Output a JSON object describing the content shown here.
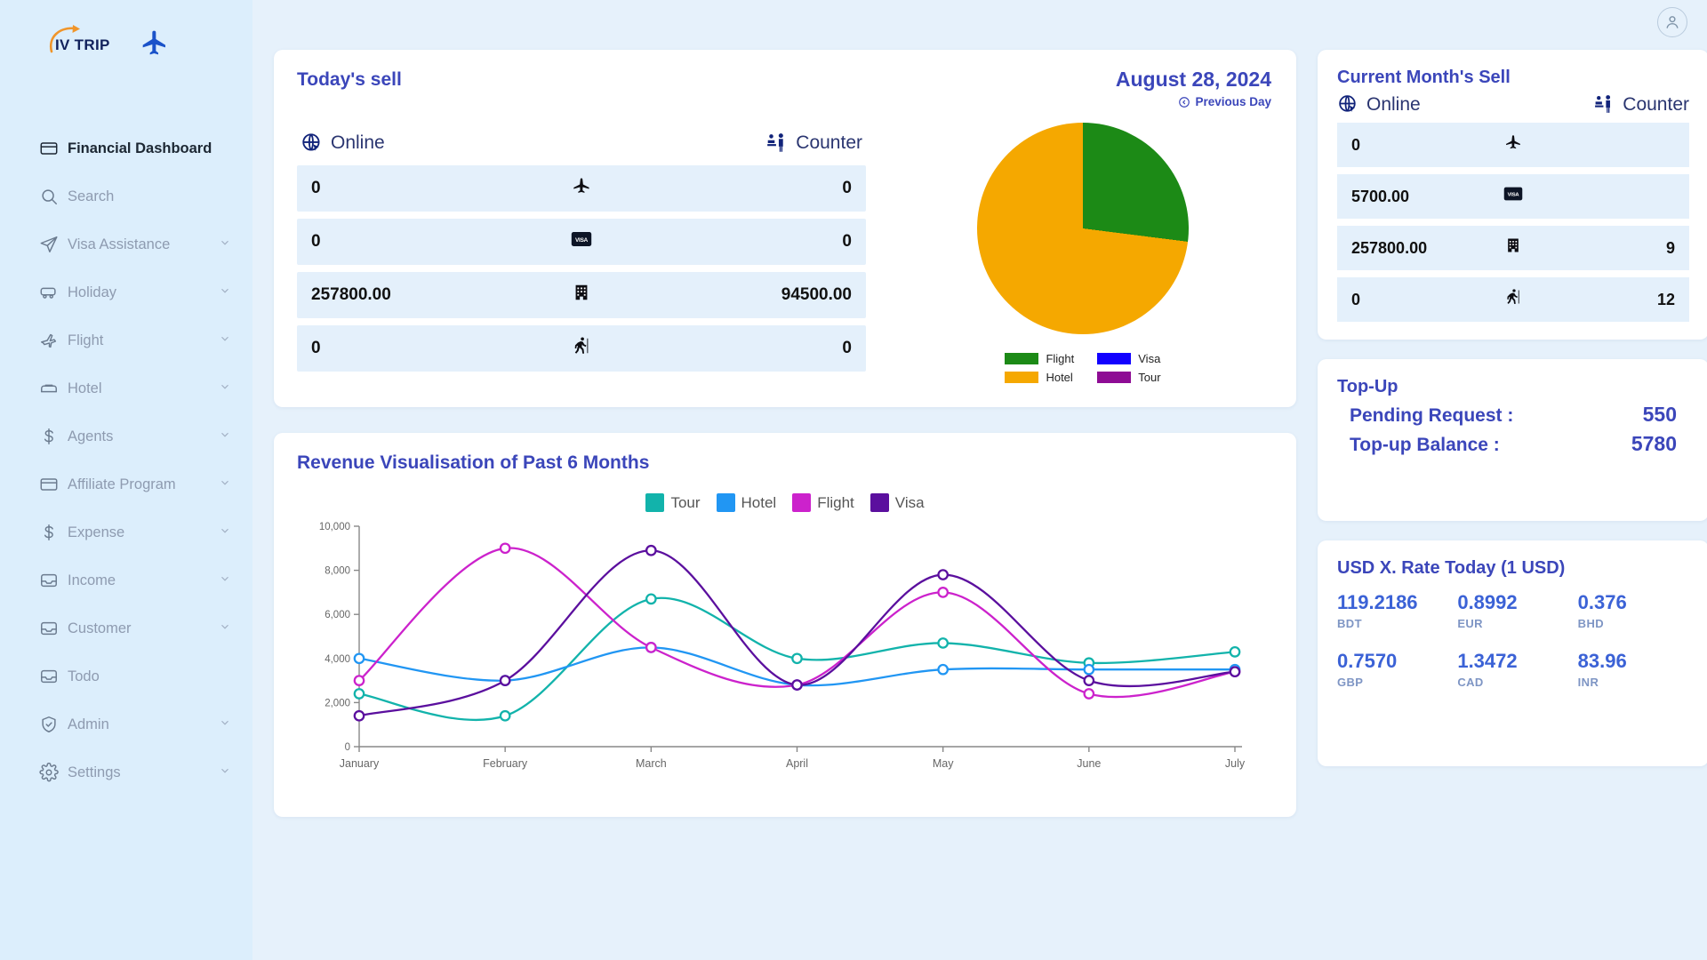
{
  "brand": {
    "name": "IV TRIP",
    "plane_icon": "airplane-icon"
  },
  "topbar": {
    "avatar_icon": "user-avatar-icon"
  },
  "sidebar": {
    "items": [
      {
        "label": "Financial Dashboard",
        "icon": "credit-card-icon",
        "active": true,
        "chevron": false
      },
      {
        "label": "Search",
        "icon": "search-icon",
        "active": false,
        "chevron": false
      },
      {
        "label": "Visa Assistance",
        "icon": "send-icon",
        "active": false,
        "chevron": true
      },
      {
        "label": "Holiday",
        "icon": "bus-icon",
        "active": false,
        "chevron": true
      },
      {
        "label": "Flight",
        "icon": "flight-icon",
        "active": false,
        "chevron": true
      },
      {
        "label": "Hotel",
        "icon": "bed-icon",
        "active": false,
        "chevron": true
      },
      {
        "label": "Agents",
        "icon": "dollar-icon",
        "active": false,
        "chevron": true
      },
      {
        "label": "Affiliate Program",
        "icon": "credit-card-icon",
        "active": false,
        "chevron": true
      },
      {
        "label": "Expense",
        "icon": "dollar-icon",
        "active": false,
        "chevron": true
      },
      {
        "label": "Income",
        "icon": "inbox-icon",
        "active": false,
        "chevron": true
      },
      {
        "label": "Customer",
        "icon": "inbox-icon",
        "active": false,
        "chevron": true
      },
      {
        "label": "Todo",
        "icon": "inbox-icon",
        "active": false,
        "chevron": false
      },
      {
        "label": "Admin",
        "icon": "shield-check-icon",
        "active": false,
        "chevron": true
      },
      {
        "label": "Settings",
        "icon": "gear-icon",
        "active": false,
        "chevron": true
      }
    ]
  },
  "todays_sell": {
    "title": "Today's sell",
    "date": "August 28, 2024",
    "previous_day_label": "Previous Day",
    "col_online": "Online",
    "col_counter": "Counter",
    "rows": [
      {
        "icon": "airplane-icon",
        "online": "0",
        "counter": "0"
      },
      {
        "icon": "visa-card-icon",
        "online": "0",
        "counter": "0"
      },
      {
        "icon": "hotel-icon",
        "online": "257800.00",
        "counter": "94500.00"
      },
      {
        "icon": "hiking-icon",
        "online": "0",
        "counter": "0"
      }
    ]
  },
  "current_month_sell": {
    "title": "Current Month's Sell",
    "col_online": "Online",
    "col_counter": "Counter",
    "rows": [
      {
        "icon": "airplane-icon",
        "online": "0",
        "counter": ""
      },
      {
        "icon": "visa-card-icon",
        "online": "5700.00",
        "counter": ""
      },
      {
        "icon": "hotel-icon",
        "online": "257800.00",
        "counter": "9"
      },
      {
        "icon": "hiking-icon",
        "online": "0",
        "counter": "12"
      }
    ]
  },
  "topup": {
    "title": "Top-Up",
    "pending_label": "Pending Request :",
    "pending_value": "550",
    "balance_label": "Top-up Balance :",
    "balance_value": "5780"
  },
  "fx": {
    "title": "USD X. Rate Today (1 USD)",
    "rates": [
      {
        "value": "119.2186",
        "code": "BDT"
      },
      {
        "value": "0.8992",
        "code": "EUR"
      },
      {
        "value": "0.376",
        "code": "BHD"
      },
      {
        "value": "0.7570",
        "code": "GBP"
      },
      {
        "value": "1.3472",
        "code": "CAD"
      },
      {
        "value": "83.96",
        "code": "INR"
      }
    ]
  },
  "colors": {
    "accent": "#3b46ba",
    "flight_green": "#1c8a16",
    "hotel_orange": "#f5a800",
    "visa_blue": "#1200ff",
    "tour_purple": "#8e0c94",
    "line_tour": "#12b3ab",
    "line_hotel": "#2196f3",
    "line_flight": "#cc22cc",
    "line_visa": "#5b0f9e",
    "row_bg": "#e4f0fb",
    "sidebar_bg": "#dceefc"
  },
  "chart_data": [
    {
      "type": "pie",
      "title": "",
      "labels": [
        "Flight",
        "Hotel",
        "Visa",
        "Tour"
      ],
      "values": [
        27,
        73,
        0,
        0
      ],
      "colors": [
        "#1c8a16",
        "#f5a800",
        "#1200ff",
        "#8e0c94"
      ],
      "legend": "bottom-center"
    },
    {
      "type": "line",
      "title": "Revenue Visualisation of Past 6 Months",
      "categories": [
        "January",
        "February",
        "March",
        "April",
        "May",
        "June",
        "July"
      ],
      "xlabel": "",
      "ylabel": "",
      "ylim": [
        0,
        10000
      ],
      "yticks": [
        0,
        2000,
        4000,
        6000,
        8000,
        10000
      ],
      "ytick_labels": [
        "0",
        "2,000",
        "4,000",
        "6,000",
        "8,000",
        "10,000"
      ],
      "grid": false,
      "legend": "top-center",
      "series": [
        {
          "name": "Tour",
          "color": "#12b3ab",
          "values": [
            2400,
            1400,
            6700,
            4000,
            4700,
            3800,
            4300
          ]
        },
        {
          "name": "Hotel",
          "color": "#2196f3",
          "values": [
            4000,
            3000,
            4500,
            2800,
            3500,
            3500,
            3500
          ]
        },
        {
          "name": "Flight",
          "color": "#cc22cc",
          "values": [
            3000,
            9000,
            4500,
            2800,
            7000,
            2400,
            3400
          ]
        },
        {
          "name": "Visa",
          "color": "#5b0f9e",
          "values": [
            1400,
            3000,
            8900,
            2800,
            7800,
            3000,
            3400
          ]
        }
      ]
    }
  ]
}
